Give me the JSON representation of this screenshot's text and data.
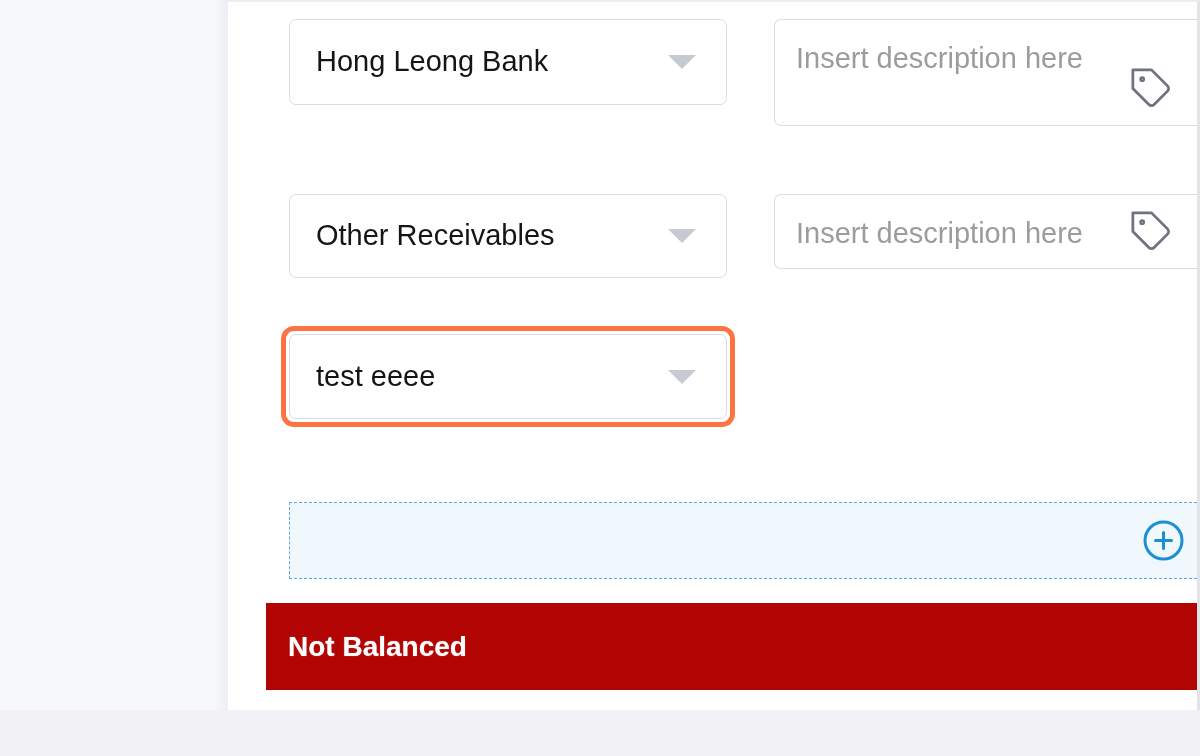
{
  "entries": [
    {
      "account": "Hong Leong Bank",
      "highlighted": false,
      "description": {
        "placeholder": "Insert description here"
      }
    },
    {
      "account": "Other Receivables",
      "highlighted": false,
      "description": {
        "placeholder": "Insert description here"
      }
    },
    {
      "account": "test eeee",
      "highlighted": true
    }
  ],
  "balance_status": {
    "label": "Not Balanced",
    "balanced": false
  }
}
